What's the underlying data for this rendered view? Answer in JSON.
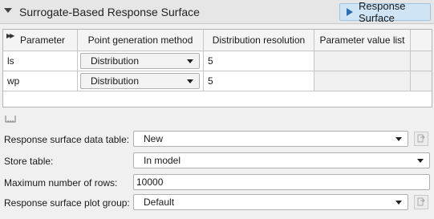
{
  "header": {
    "title": "Surrogate-Based Response Surface",
    "run_button_label": "Response Surface",
    "run_icon": "play-icon"
  },
  "table": {
    "columns": [
      "Parameter",
      "Point generation method",
      "Distribution resolution",
      "Parameter value list"
    ],
    "rows": [
      {
        "parameter": "ls",
        "method": "Distribution",
        "resolution": "5",
        "value_list": ""
      },
      {
        "parameter": "wp",
        "method": "Distribution",
        "resolution": "5",
        "value_list": ""
      }
    ]
  },
  "form": {
    "data_table": {
      "label": "Response surface data table:",
      "value": "New"
    },
    "store_table": {
      "label": "Store table:",
      "value": "In model"
    },
    "max_rows": {
      "label": "Maximum number of rows:",
      "value": "10000"
    },
    "plot_group": {
      "label": "Response surface plot group:",
      "value": "Default"
    }
  },
  "colors": {
    "accent_button": "#cfe4f5",
    "play_icon": "#2a6fb3"
  }
}
